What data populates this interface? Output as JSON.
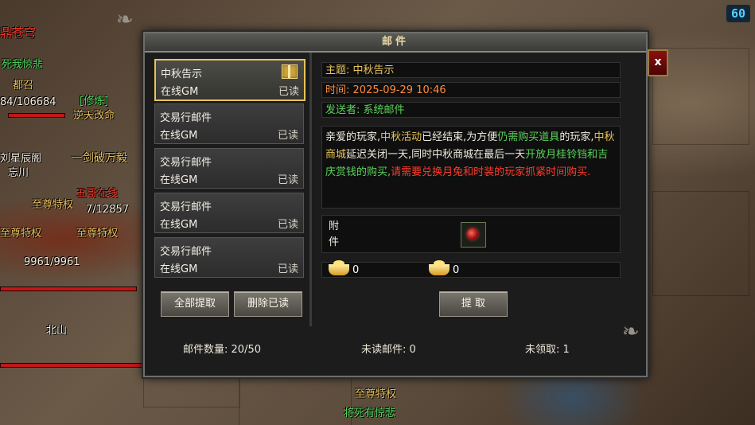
{
  "fps": "60",
  "background": {
    "texts": [
      "鼎苍穹",
      "死我惊悲",
      "都召",
      "84/106684",
      "[修炼]",
      "逆天改命",
      "刘星辰阁",
      "忘川",
      "一剑破万毅",
      "至尊特权",
      "五哥在线",
      "7/12857",
      "至尊特权",
      "至尊特权",
      "9961/9961",
      "北山",
      "至尊特权",
      "将死有惊悲"
    ]
  },
  "mail_window": {
    "title": "邮件",
    "close_label": "x",
    "mail_list": [
      {
        "subject": "中秋告示",
        "sender": "在线GM",
        "status": "已读",
        "has_gift": true,
        "selected": true
      },
      {
        "subject": "交易行邮件",
        "sender": "在线GM",
        "status": "已读"
      },
      {
        "subject": "交易行邮件",
        "sender": "在线GM",
        "status": "已读"
      },
      {
        "subject": "交易行邮件",
        "sender": "在线GM",
        "status": "已读"
      },
      {
        "subject": "交易行邮件",
        "sender": "在线GM",
        "status": "已读"
      }
    ],
    "buttons": {
      "claim_all": "全部提取",
      "delete_read": "删除已读",
      "claim": "提 取"
    },
    "detail": {
      "subject_label": "主题:",
      "subject": "中秋告示",
      "time_label": "时间:",
      "time": "2025-09-29 10:46",
      "sender_label": "发送者:",
      "sender": "系统邮件",
      "body_segments": [
        {
          "text": "亲爱的玩家,",
          "color": "#f0ece0"
        },
        {
          "text": "中秋活动",
          "color": "#e6c35a"
        },
        {
          "text": "已经结束,为方便",
          "color": "#f0ece0"
        },
        {
          "text": "仍需购买道具",
          "color": "#5ad45a"
        },
        {
          "text": "的玩家,",
          "color": "#f0ece0"
        },
        {
          "text": "中秋商城",
          "color": "#e6c35a"
        },
        {
          "text": "延迟关闭一天,同时中秋商城在最后一天",
          "color": "#f0ece0"
        },
        {
          "text": "开放月桂铃铛和吉庆赏钱的购买,",
          "color": "#5ad45a"
        },
        {
          "text": "请需要兑换月兔和时装的玩家抓紧时间购买.",
          "color": "#ff3b2b"
        }
      ],
      "attachment_label": "附件",
      "gold_amount": "0",
      "yuanbao_amount": "0"
    },
    "footer": {
      "mail_count_label": "邮件数量:",
      "mail_count": "20/50",
      "unread_label": "未读邮件:",
      "unread": "0",
      "unclaimed_label": "未领取:",
      "unclaimed": "1"
    }
  }
}
